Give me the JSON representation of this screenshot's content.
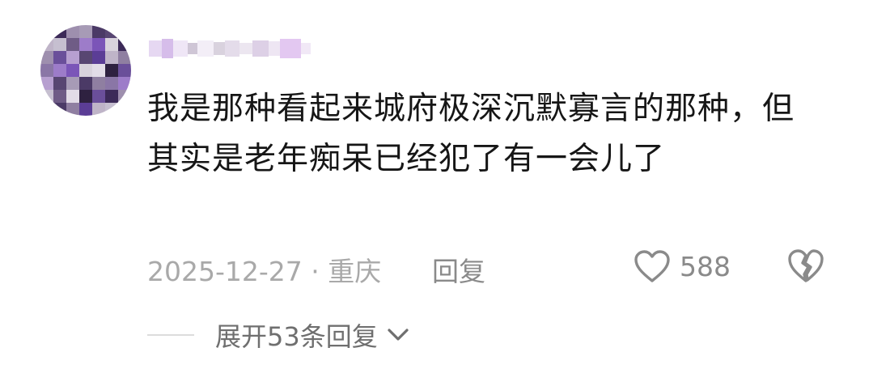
{
  "comment": {
    "text": "我是那种看起来城府极深沉默寡言的那种，但其实是老年痴呆已经犯了有一会儿了",
    "date_location": "2025-12-27 · 重庆",
    "reply_label": "回复",
    "like_count": "588",
    "expand_label": "展开53条回复",
    "colors": {
      "text": "#161616",
      "meta": "#a9a9a9",
      "action": "#8a8a8a",
      "username_blur": "#dcc4ee"
    },
    "icons": {
      "like": "heart-outline-icon",
      "dislike": "broken-heart-icon",
      "expand": "chevron-down-icon"
    }
  }
}
